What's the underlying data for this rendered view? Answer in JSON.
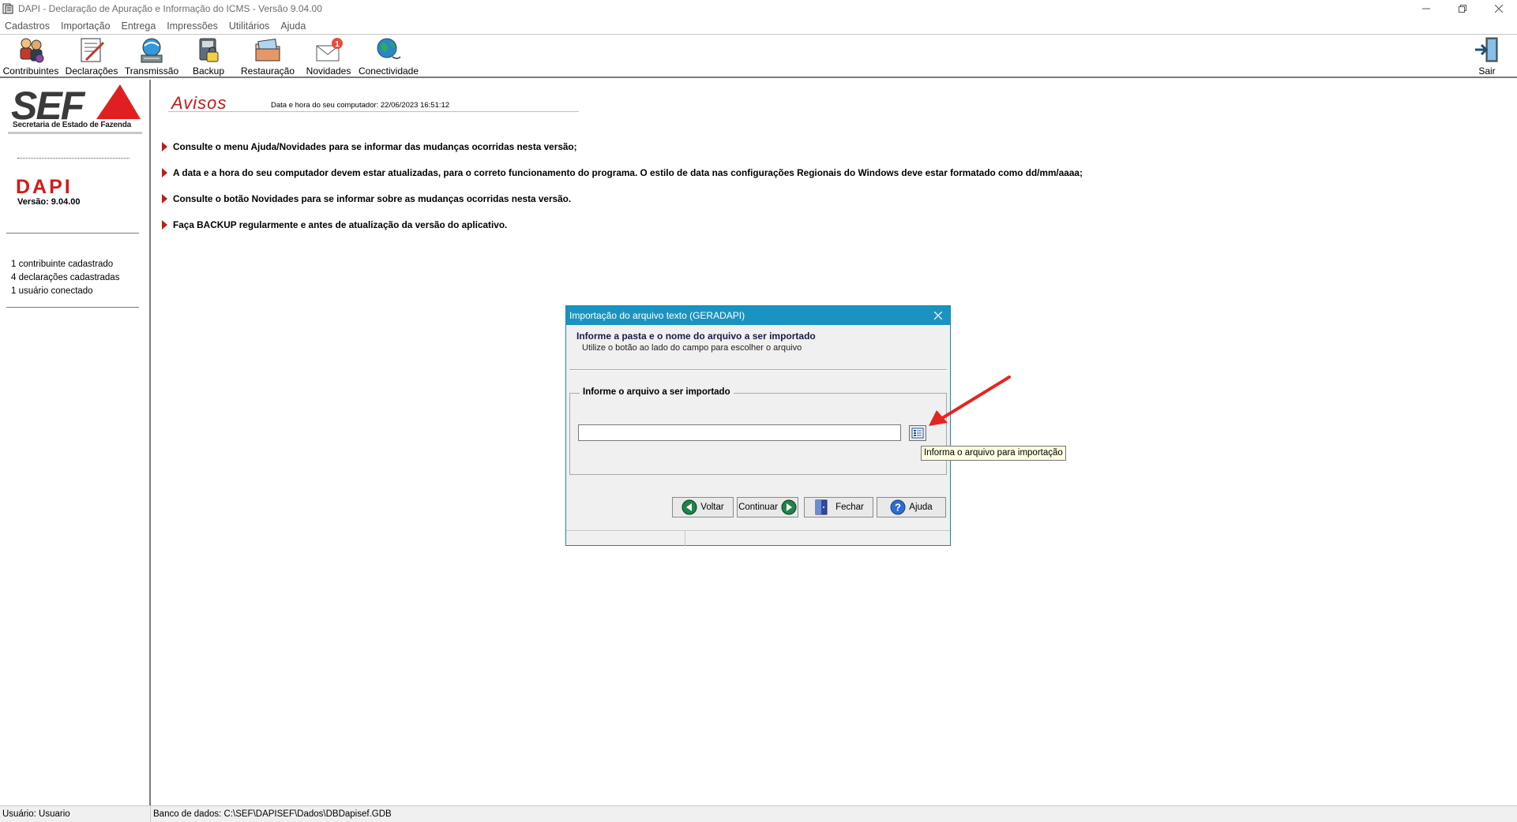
{
  "window": {
    "title": "DAPI - Declaração de Apuração e Informação do ICMS - Versão 9.04.00"
  },
  "menu": {
    "items": [
      "Cadastros",
      "Importação",
      "Entrega",
      "Impressões",
      "Utilitários",
      "Ajuda"
    ]
  },
  "toolbar": {
    "contribuintes": "Contribuintes",
    "declaracoes": "Declarações",
    "transmissao": "Transmissão",
    "backup": "Backup",
    "restauracao": "Restauração",
    "novidades": "Novidades",
    "novidades_badge": "1",
    "conectividade": "Conectividade",
    "sair": "Sair"
  },
  "sidebar": {
    "logo_text": "SEF",
    "logo_subtitle": "Secretaria de Estado de Fazenda",
    "app_name": "DAPI",
    "version": "Versão: 9.04.00",
    "stats": [
      "1 contribuinte cadastrado",
      "4 declarações cadastradas",
      "1 usuário conectado"
    ]
  },
  "main": {
    "title": "Avisos",
    "datetime": "Data e hora do seu computador: 22/06/2023 16:51:12",
    "notices": [
      "Consulte o menu Ajuda/Novidades para se informar das mudanças ocorridas nesta versão;",
      "A data e a hora do seu computador devem estar atualizadas, para o correto funcionamento do programa. O estilo de data nas configurações Regionais do Windows deve estar formatado como dd/mm/aaaa;",
      "Consulte o botão Novidades para se informar sobre as mudanças ocorridas nesta versão.",
      "Faça BACKUP regularmente e antes de atualização da versão do aplicativo."
    ]
  },
  "dialog": {
    "title": "Importação do arquivo texto (GERADAPI)",
    "heading": "Informe a pasta e o nome do arquivo a ser importado",
    "subheading": "Utilize o botão ao lado do campo para escolher o arquivo",
    "group_label": "Informe o arquivo a ser importado",
    "file_value": "",
    "tooltip": "Informa o arquivo para importação",
    "buttons": {
      "voltar": "Voltar",
      "continuar": "Continuar",
      "fechar": "Fechar",
      "ajuda": "Ajuda"
    }
  },
  "statusbar": {
    "user": "Usuário: Usuario",
    "database": "Banco de dados: C:\\SEF\\DAPISEF\\Dados\\DBDapisef.GDB"
  },
  "colors": {
    "accent_red": "#c21a1a",
    "dialog_title": "#1b93c0"
  }
}
